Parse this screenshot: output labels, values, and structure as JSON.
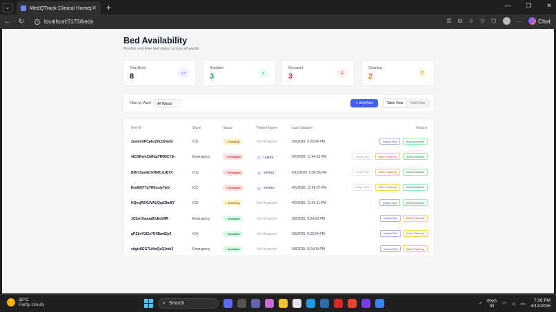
{
  "browser": {
    "tab_title": "MedQTrack Clinical Homepage",
    "url": "localhost:5173/beds",
    "chat_label": "Chat"
  },
  "page": {
    "title": "Bed Availability",
    "subtitle": "Monitor real-time bed status across all wards"
  },
  "stats": [
    {
      "label": "Total Beds",
      "value": "8",
      "color": "#111827",
      "icon": "bed-icon",
      "icon_bg": "#eef2ff",
      "icon_color": "#4f46e5"
    },
    {
      "label": "Available",
      "value": "3",
      "color": "#16a34a",
      "icon": "check-circle-icon",
      "icon_bg": "#ecfdf5",
      "icon_color": "#16a34a"
    },
    {
      "label": "Occupied",
      "value": "3",
      "color": "#dc2626",
      "icon": "user-icon",
      "icon_bg": "#fef2f2",
      "icon_color": "#dc2626"
    },
    {
      "label": "Cleaning",
      "value": "2",
      "color": "#d97706",
      "icon": "broom-icon",
      "icon_bg": "#fffbeb",
      "icon_color": "#d97706"
    }
  ],
  "filter": {
    "label": "Filter by Ward",
    "selected": "All Wards",
    "add_label": "Add Bed",
    "view_table": "Table View",
    "view_grid": "Grid View"
  },
  "table": {
    "headers": {
      "bed_id": "Bed ID",
      "ward": "Ward",
      "status": "Status",
      "patient": "Patient Name",
      "updated": "Last Updated",
      "actions": "Actions"
    },
    "rows": [
      {
        "bed_id": "2owocXPCpbsZhiZ2rEwU",
        "ward": "ICU",
        "status": "Cleaning",
        "patient": "Not Assigned",
        "patient_initial": "",
        "updated": "3/8/2026, 5:29:24 PM"
      },
      {
        "bed_id": "4iCGRsmCbRdaTR0BCYjk",
        "ward": "Emergency",
        "status": "Occupied",
        "patient": "raama",
        "patient_initial": "r",
        "updated": "4/5/2026, 11:44:53 PM"
      },
      {
        "bed_id": "BMrxSas42JeN6fCsUB7X",
        "ward": "ICU",
        "status": "Occupied",
        "patient": "simran",
        "patient_initial": "s",
        "updated": "4/12/2026, 6:54:36 PM"
      },
      {
        "bed_id": "EneE0jT7pTHEsuty7jxb",
        "ward": "ICU",
        "status": "Occupied",
        "patient": "simran",
        "patient_initial": "s",
        "updated": "4/5/2026, 11:45:07 PM"
      },
      {
        "bed_id": "HQesjR2XUVAUQqd3bn8Y",
        "ward": "ICU",
        "status": "Cleaning",
        "patient": "Not Assigned",
        "patient_initial": "",
        "updated": "4/5/2026, 11:45:11 PM"
      },
      {
        "bed_id": "JCIber9vpuaIDvEeSfIR",
        "ward": "Emergency",
        "status": "Available",
        "patient": "Not Assigned",
        "patient_initial": "",
        "updated": "3/8/2026, 5:24:09 PM"
      },
      {
        "bed_id": "qPZbrYGf2x7G4BmtEjy6",
        "ward": "ICU",
        "status": "Available",
        "patient": "Not Assigned",
        "patient_initial": "",
        "updated": "3/8/2026, 5:23:54 PM"
      },
      {
        "bed_id": "vbgiz8GG7LHtoQvQJmb3",
        "ward": "Emergency",
        "status": "Available",
        "patient": "Not Assigned",
        "patient_initial": "",
        "updated": "3/8/2026, 5:24:09 PM"
      }
    ],
    "action_labels": {
      "assign": "Assign Bed",
      "clean": "Mark Cleaning",
      "avail": "Mark Available"
    }
  },
  "taskbar": {
    "temp": "32°C",
    "weather": "Partly cloudy",
    "search": "Search",
    "lang1": "ENG",
    "lang2": "IN",
    "time": "7:26 PM",
    "date": "4/12/2026"
  }
}
